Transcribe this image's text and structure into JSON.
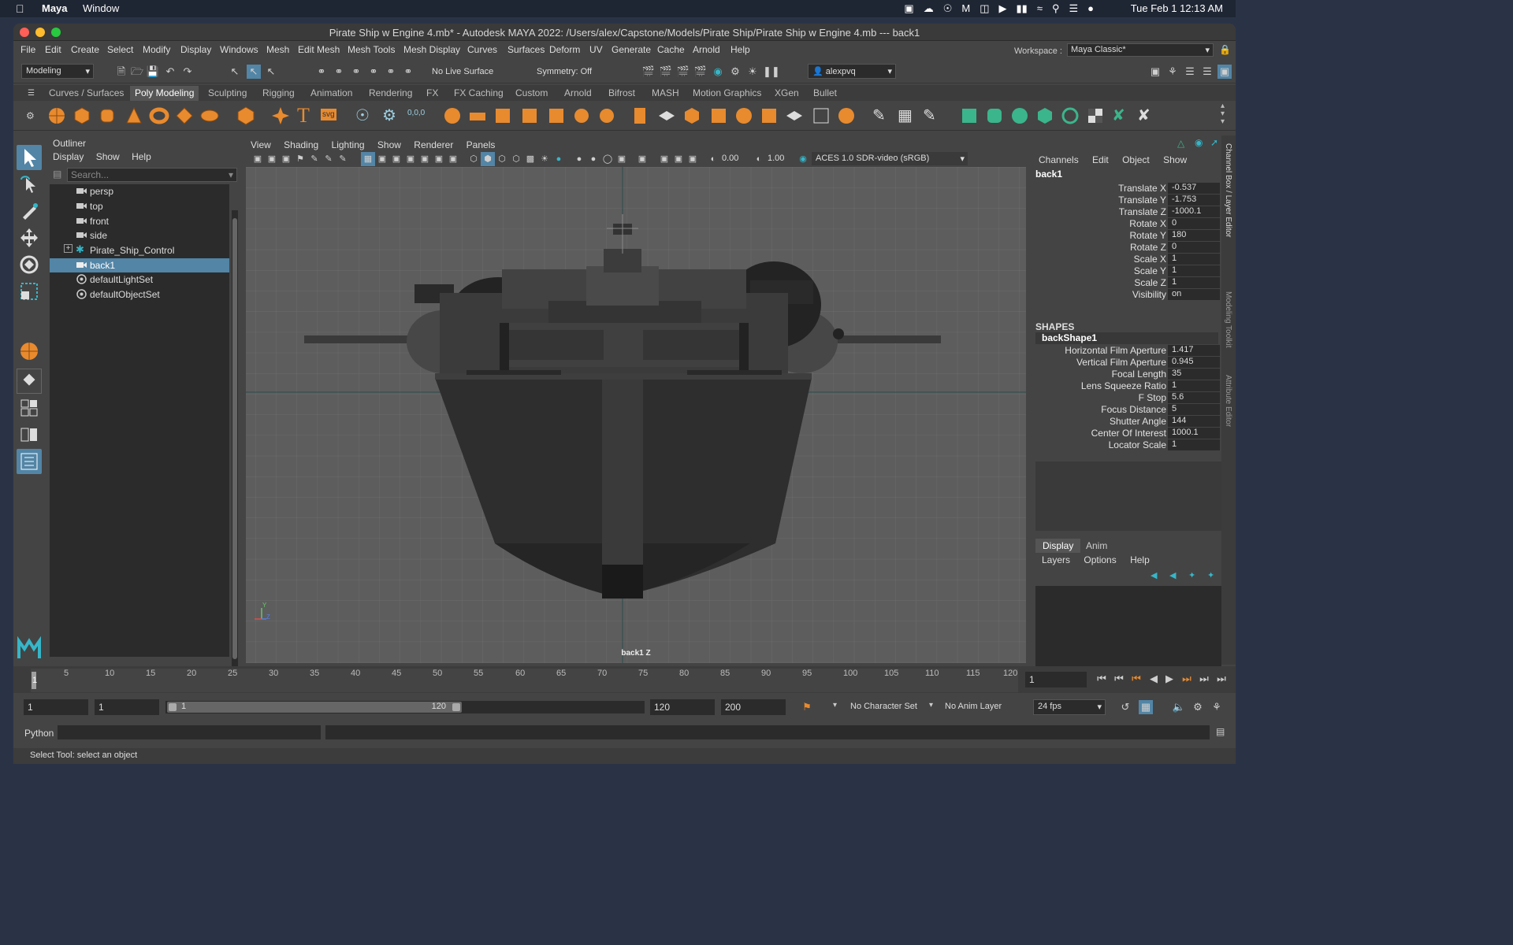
{
  "mac_menubar": {
    "app_name": "Maya",
    "window_menu": "Window",
    "clock": "Tue Feb 1  12:13 AM"
  },
  "window": {
    "title": "Pirate Ship w Engine 4.mb* - Autodesk MAYA 2022: /Users/alex/Capstone/Models/Pirate Ship/Pirate Ship w Engine 4.mb  ---  back1"
  },
  "menus": [
    "File",
    "Edit",
    "Create",
    "Select",
    "Modify",
    "Display",
    "Windows",
    "Mesh",
    "Edit Mesh",
    "Mesh Tools",
    "Mesh Display",
    "Curves",
    "Surfaces",
    "Deform",
    "UV",
    "Generate",
    "Cache",
    "Arnold",
    "Help"
  ],
  "workspace": {
    "label": "Workspace :",
    "value": "Maya Classic*"
  },
  "status_line": {
    "mode": "Modeling",
    "live_surface": "No Live Surface",
    "symmetry": "Symmetry: Off",
    "user": "alexpvq"
  },
  "shelf_tabs": [
    "Curves / Surfaces",
    "Poly Modeling",
    "Sculpting",
    "Rigging",
    "Animation",
    "Rendering",
    "FX",
    "FX Caching",
    "Custom",
    "Arnold",
    "Bifrost",
    "MASH",
    "Motion Graphics",
    "XGen",
    "Bullet"
  ],
  "shelf_active": "Poly Modeling",
  "outliner": {
    "title": "Outliner",
    "menus": [
      "Display",
      "Show",
      "Help"
    ],
    "search_placeholder": "Search...",
    "items": [
      {
        "label": "persp",
        "icon": "camera-icon",
        "selected": false
      },
      {
        "label": "top",
        "icon": "camera-icon",
        "selected": false
      },
      {
        "label": "front",
        "icon": "camera-icon",
        "selected": false
      },
      {
        "label": "side",
        "icon": "camera-icon",
        "selected": false
      },
      {
        "label": "Pirate_Ship_Control",
        "icon": "control-icon",
        "selected": false,
        "expandable": true
      },
      {
        "label": "back1",
        "icon": "camera-icon",
        "selected": true
      },
      {
        "label": "defaultLightSet",
        "icon": "set-icon",
        "selected": false
      },
      {
        "label": "defaultObjectSet",
        "icon": "set-icon",
        "selected": false
      }
    ]
  },
  "viewport": {
    "menus": [
      "View",
      "Shading",
      "Lighting",
      "Show",
      "Renderer",
      "Panels"
    ],
    "exposure": "0.00",
    "gamma": "1.00",
    "color_space": "ACES 1.0 SDR-video (sRGB)",
    "camera_label": "back1 Z",
    "axis_y": "Y",
    "axis_z": "Z"
  },
  "channel_box": {
    "menus": [
      "Channels",
      "Edit",
      "Object",
      "Show"
    ],
    "object": "back1",
    "attributes": [
      {
        "name": "Translate X",
        "value": "-0.537"
      },
      {
        "name": "Translate Y",
        "value": "-1.753"
      },
      {
        "name": "Translate Z",
        "value": "-1000.1"
      },
      {
        "name": "Rotate X",
        "value": "0"
      },
      {
        "name": "Rotate Y",
        "value": "180"
      },
      {
        "name": "Rotate Z",
        "value": "0"
      },
      {
        "name": "Scale X",
        "value": "1"
      },
      {
        "name": "Scale Y",
        "value": "1"
      },
      {
        "name": "Scale Z",
        "value": "1"
      },
      {
        "name": "Visibility",
        "value": "on"
      }
    ],
    "shapes_label": "SHAPES",
    "shape_name": "backShape1",
    "shape_attributes": [
      {
        "name": "Horizontal Film Aperture",
        "value": "1.417"
      },
      {
        "name": "Vertical Film Aperture",
        "value": "0.945"
      },
      {
        "name": "Focal Length",
        "value": "35"
      },
      {
        "name": "Lens Squeeze Ratio",
        "value": "1"
      },
      {
        "name": "F Stop",
        "value": "5.6"
      },
      {
        "name": "Focus Distance",
        "value": "5"
      },
      {
        "name": "Shutter Angle",
        "value": "144"
      },
      {
        "name": "Center Of Interest",
        "value": "1000.1"
      },
      {
        "name": "Locator Scale",
        "value": "1"
      }
    ],
    "layer_tabs": [
      "Display",
      "Anim"
    ],
    "layer_menus": [
      "Layers",
      "Options",
      "Help"
    ],
    "side_tabs": [
      "Channel Box / Layer Editor",
      "Modeling Toolkit",
      "Attribute Editor"
    ]
  },
  "timeline": {
    "ticks": [
      "1",
      "5",
      "10",
      "15",
      "20",
      "25",
      "30",
      "35",
      "40",
      "45",
      "50",
      "55",
      "60",
      "65",
      "70",
      "75",
      "80",
      "85",
      "90",
      "95",
      "100",
      "105",
      "110",
      "115",
      "120"
    ],
    "current_frame": "1"
  },
  "range": {
    "start": "1",
    "playback_start": "1",
    "range_start": "1",
    "range_end": "120",
    "playback_end": "120",
    "end": "200",
    "character_set": "No Character Set",
    "anim_layer": "No Anim Layer",
    "fps": "24 fps"
  },
  "command_line": {
    "label": "Python"
  },
  "help_line": "Select Tool: select an object"
}
